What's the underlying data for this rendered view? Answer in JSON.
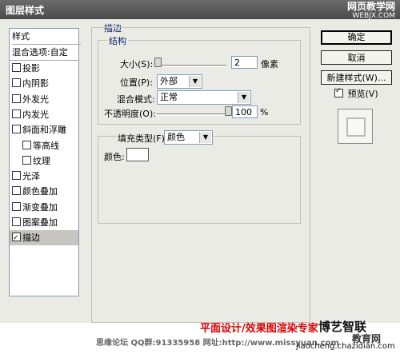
{
  "window": {
    "title": "图层样式"
  },
  "watermark": {
    "site": "网页教学网",
    "site_url": "WEBJX.COM",
    "red_text": "平面设计/效果图渲染专家",
    "contact": "思缘论坛 QQ群:91335958  网址:http://www.missyuan.com",
    "brand": "博艺智联",
    "brand2": "教育网",
    "url": "jiaocheng.chazidian.com"
  },
  "style_list": {
    "header": "样式",
    "blend_options": "混合选项:自定",
    "items": [
      {
        "label": "投影",
        "checked": false,
        "indent": false
      },
      {
        "label": "内阴影",
        "checked": false,
        "indent": false
      },
      {
        "label": "外发光",
        "checked": false,
        "indent": false
      },
      {
        "label": "内发光",
        "checked": false,
        "indent": false
      },
      {
        "label": "斜面和浮雕",
        "checked": false,
        "indent": false
      },
      {
        "label": "等高线",
        "checked": false,
        "indent": true
      },
      {
        "label": "纹理",
        "checked": false,
        "indent": true
      },
      {
        "label": "光泽",
        "checked": false,
        "indent": false
      },
      {
        "label": "颜色叠加",
        "checked": false,
        "indent": false
      },
      {
        "label": "渐变叠加",
        "checked": false,
        "indent": false
      },
      {
        "label": "图案叠加",
        "checked": false,
        "indent": false
      },
      {
        "label": "描边",
        "checked": true,
        "indent": false,
        "selected": true
      }
    ]
  },
  "stroke": {
    "title": "描边",
    "structure": {
      "title": "结构",
      "size_label": "大小(S):",
      "size_value": "2",
      "size_unit": "像素",
      "position_label": "位置(P):",
      "position_value": "外部",
      "blend_label": "混合模式:",
      "blend_value": "正常",
      "opacity_label": "不透明度(O):",
      "opacity_value": "100",
      "opacity_unit": "%"
    },
    "fill": {
      "type_label": "填充类型(F):",
      "type_value": "颜色",
      "color_label": "颜色:",
      "color_value": "#ffffff"
    }
  },
  "buttons": {
    "ok": "确定",
    "cancel": "取消",
    "new_style": "新建样式(W)...",
    "preview": "预览(V)",
    "preview_checked": true
  }
}
